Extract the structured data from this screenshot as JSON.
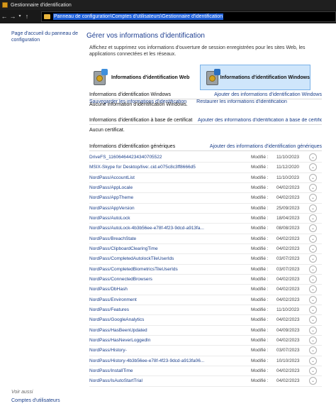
{
  "window": {
    "title": "Gestionnaire d'identification"
  },
  "address": {
    "path": "Panneau de configuration\\Comptes d'utilisateurs\\Gestionnaire d'identification"
  },
  "sidebar": {
    "home_link": "Page d'accueil du panneau de configuration",
    "see_also": "Voir aussi",
    "users_link": "Comptes d'utilisateurs"
  },
  "main": {
    "title": "Gérer vos informations d'identification",
    "intro": "Affichez et supprimez vos informations d'ouverture de session enregistrées pour les sites Web, les applications connectées et les réseaux.",
    "vault_web": "Informations d'identification Web",
    "vault_windows": "Informations d'identification Windows",
    "backup_link": "Sauvegarder les informations d'identification",
    "restore_link": "Restaurer les informations d'identification"
  },
  "windows_section": {
    "title": "Informations d'identification Windows",
    "add_link": "Ajouter des informations d'identification Windows",
    "empty": "Aucune information d'identification Windows."
  },
  "cert_section": {
    "title": "Informations d'identification à base de certificat",
    "add_link": "Ajouter des informations d'identification à base de certificat",
    "empty": "Aucun certificat."
  },
  "generic_section": {
    "title": "Informations d'identification génériques",
    "add_link": "Ajouter des informations d'identification génériques",
    "modified_label": "Modifié :",
    "items": [
      {
        "name": "DriveFS_116064644234340705522",
        "date": "11/10/2023"
      },
      {
        "name": "MSIX-Skype for Desktop/live:.cid.e075c8c3ff8666d5",
        "date": "11/12/2020"
      },
      {
        "name": "NordPass/AccountList",
        "date": "11/10/2023"
      },
      {
        "name": "NordPass/AppLocale",
        "date": "04/02/2023"
      },
      {
        "name": "NordPass/AppTheme",
        "date": "04/02/2023"
      },
      {
        "name": "NordPass/AppVersion",
        "date": "25/09/2023"
      },
      {
        "name": "NordPass/AutoLock",
        "date": "18/04/2023"
      },
      {
        "name": "NordPass/AutoLock-4b3b56ee-e78f-4f23-9dcd-a913fa...",
        "date": "08/08/2023"
      },
      {
        "name": "NordPass/BreachState",
        "date": "04/02/2023"
      },
      {
        "name": "NordPass/ClipboardClearingTime",
        "date": "04/02/2023"
      },
      {
        "name": "NordPass/CompletedAutolockTileUserIds",
        "date": "03/07/2023"
      },
      {
        "name": "NordPass/CompletedBiometricsTileUserIds",
        "date": "03/07/2023"
      },
      {
        "name": "NordPass/ConnectedBrowsers",
        "date": "04/02/2023"
      },
      {
        "name": "NordPass/DbHash",
        "date": "04/02/2023"
      },
      {
        "name": "NordPass/Environment",
        "date": "04/02/2023"
      },
      {
        "name": "NordPass/Features",
        "date": "11/10/2023"
      },
      {
        "name": "NordPass/GoogleAnalytics",
        "date": "04/02/2023"
      },
      {
        "name": "NordPass/HasBeenUpdated",
        "date": "04/09/2023"
      },
      {
        "name": "NordPass/HasNeverLoggedIn",
        "date": "04/02/2023"
      },
      {
        "name": "NordPass/History-",
        "date": "03/07/2023"
      },
      {
        "name": "NordPass/History-4b3b56ee-e78f-4f23-9dcd-a913fa06...",
        "date": "10/10/2023"
      },
      {
        "name": "NordPass/InstallTime",
        "date": "04/02/2023"
      },
      {
        "name": "NordPass/IsAutoStartTrial",
        "date": "04/02/2023"
      }
    ]
  }
}
